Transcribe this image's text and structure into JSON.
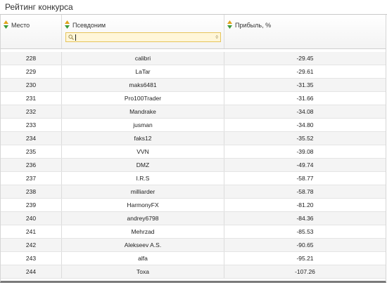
{
  "title": "Рейтинг конкурса",
  "columns": {
    "place": "Место",
    "nickname": "Псевдоним",
    "profit": "Прибыль, %"
  },
  "filter": {
    "value": ""
  },
  "rows": [
    {
      "place": "228",
      "nick": "calibri",
      "profit": "-29.45"
    },
    {
      "place": "229",
      "nick": "LaTar",
      "profit": "-29.61"
    },
    {
      "place": "230",
      "nick": "maks6481",
      "profit": "-31.35"
    },
    {
      "place": "231",
      "nick": "Pro100Trader",
      "profit": "-31.66"
    },
    {
      "place": "232",
      "nick": "Mandrake",
      "profit": "-34.08"
    },
    {
      "place": "233",
      "nick": "jusman",
      "profit": "-34.80"
    },
    {
      "place": "234",
      "nick": "faks12",
      "profit": "-35.52"
    },
    {
      "place": "235",
      "nick": "VVN",
      "profit": "-39.08"
    },
    {
      "place": "236",
      "nick": "DMZ",
      "profit": "-49.74"
    },
    {
      "place": "237",
      "nick": "I.R.S",
      "profit": "-58.77"
    },
    {
      "place": "238",
      "nick": "milliarder",
      "profit": "-58.78"
    },
    {
      "place": "239",
      "nick": "HarmonyFX",
      "profit": "-81.20"
    },
    {
      "place": "240",
      "nick": "andrey6798",
      "profit": "-84.36"
    },
    {
      "place": "241",
      "nick": "Mehrzad",
      "profit": "-85.53"
    },
    {
      "place": "242",
      "nick": "Alekseev A.S.",
      "profit": "-90.65"
    },
    {
      "place": "243",
      "nick": "alfa",
      "profit": "-95.21"
    },
    {
      "place": "244",
      "nick": "Toxa",
      "profit": "-107.26"
    }
  ],
  "icons": {
    "sort": "sort-up-down-icon",
    "search": "search-icon"
  },
  "colors": {
    "sort_up": "#e0a31b",
    "sort_down": "#3a9a3a",
    "filter_bg": "#fff6d8",
    "filter_border": "#e6c45a"
  }
}
